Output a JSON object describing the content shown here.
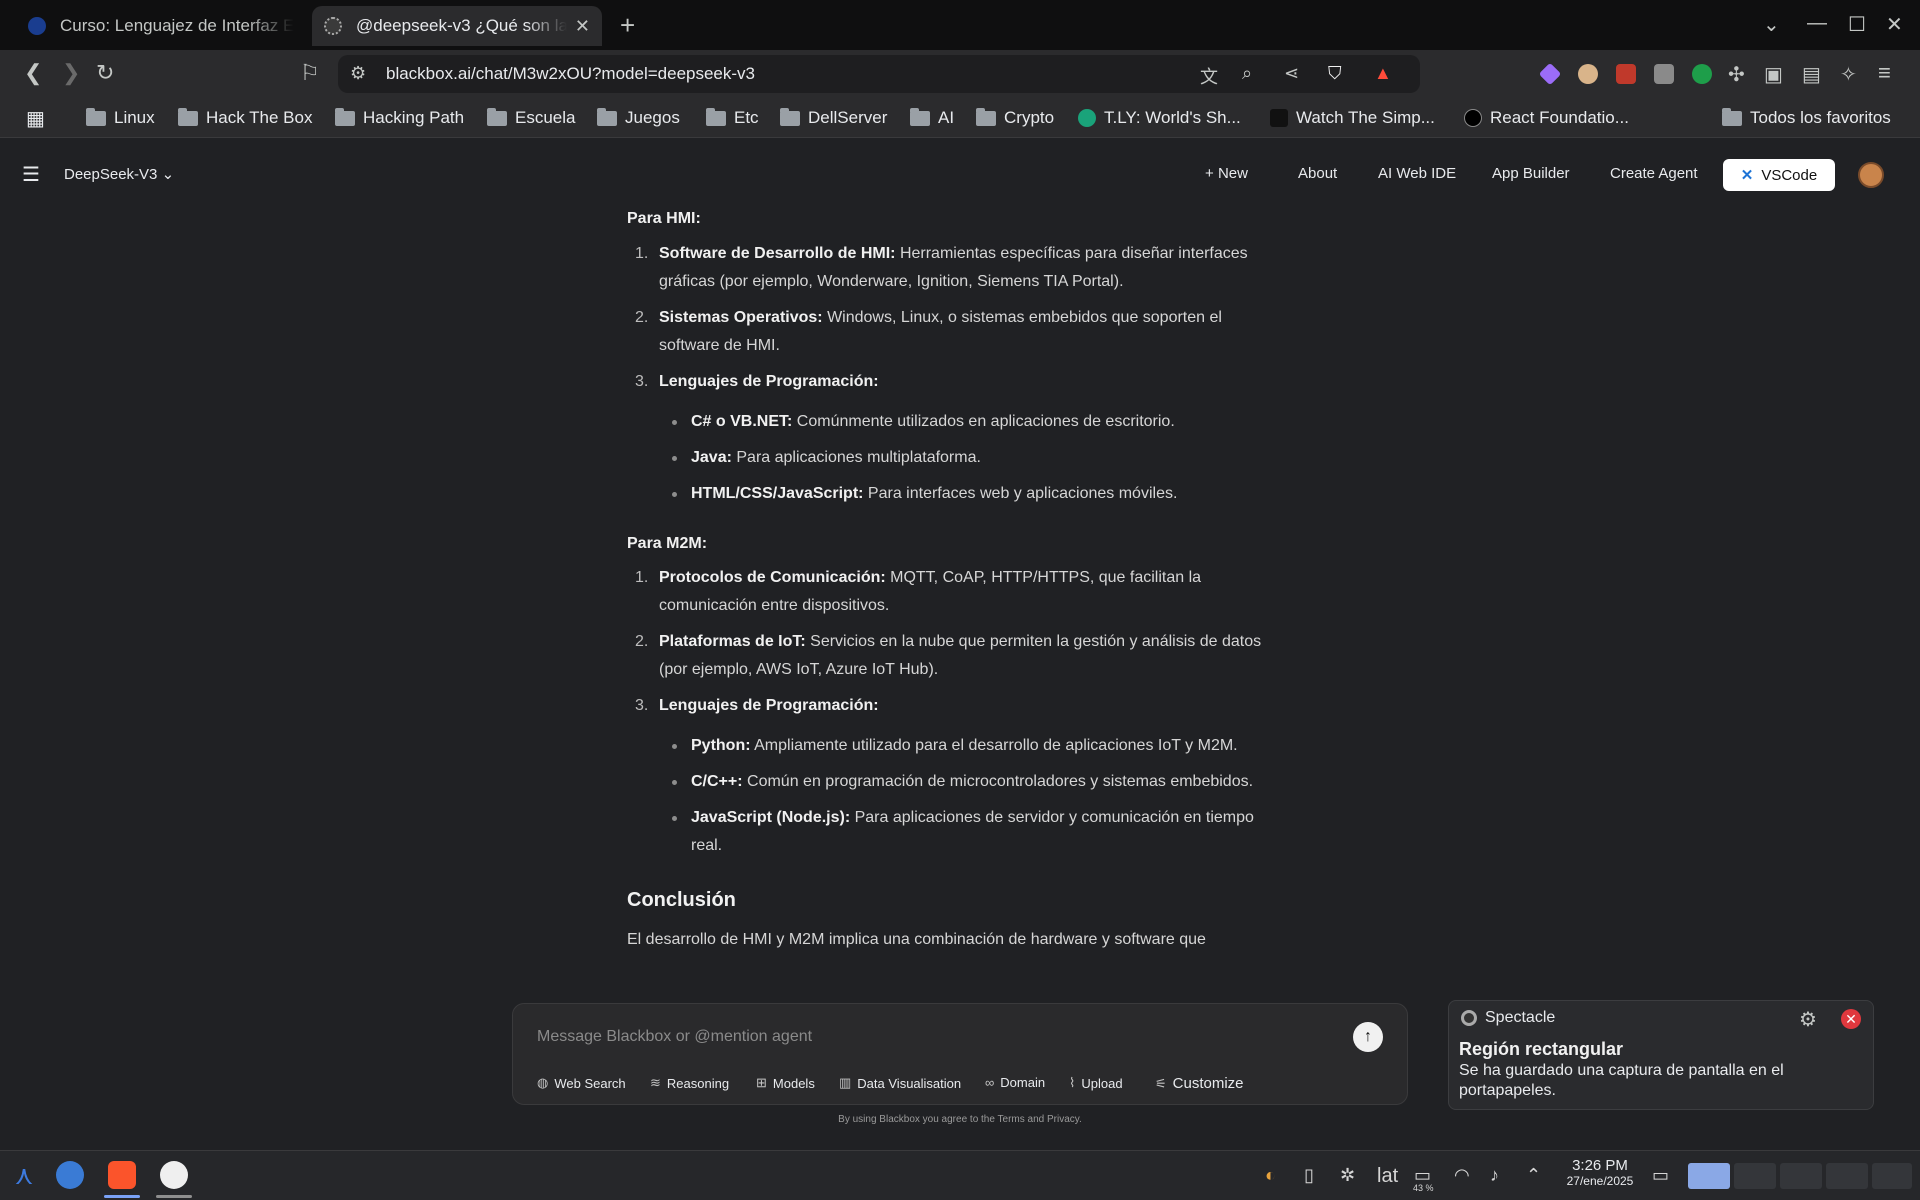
{
  "browser": {
    "tabs": [
      {
        "title": "Curso: Lenguajez de Interfaz E"
      },
      {
        "title": "@deepseek-v3 ¿Qué son la"
      }
    ],
    "url": "blackbox.ai/chat/M3w2xOU?model=deepseek-v3",
    "bookmarks": [
      {
        "label": "Linux",
        "icon": "folder-icon"
      },
      {
        "label": "Hack The Box",
        "icon": "folder-icon"
      },
      {
        "label": "Hacking Path",
        "icon": "folder-icon"
      },
      {
        "label": "Escuela",
        "icon": "folder-icon"
      },
      {
        "label": "Juegos",
        "icon": "folder-icon"
      },
      {
        "label": "Etc",
        "icon": "folder-icon"
      },
      {
        "label": "DellServer",
        "icon": "folder-icon"
      },
      {
        "label": "AI",
        "icon": "folder-icon"
      },
      {
        "label": "Crypto",
        "icon": "folder-icon"
      },
      {
        "label": "T.LY: World's Sh...",
        "icon": "tly-icon"
      },
      {
        "label": "Watch The Simp...",
        "icon": "tv-icon"
      },
      {
        "label": "React Foundatio...",
        "icon": "nextjs-icon"
      }
    ],
    "all_bookmarks": "Todos los favoritos"
  },
  "header": {
    "model": "DeepSeek-V3",
    "new": "New",
    "about": "About",
    "ai_web_ide": "AI Web IDE",
    "app_builder": "App Builder",
    "create_agent": "Create Agent",
    "vscode": "VSCode"
  },
  "content": {
    "hmi_heading": "Para HMI:",
    "hmi_items": [
      {
        "num": "1.",
        "bold": "Software de Desarrollo de HMI:",
        "text": " Herramientas específicas para diseñar interfaces gráficas (por ejemplo, Wonderware, Ignition, Siemens TIA Portal)."
      },
      {
        "num": "2.",
        "bold": "Sistemas Operativos:",
        "text": " Windows, Linux, o sistemas embebidos que soporten el software de HMI."
      },
      {
        "num": "3.",
        "bold": "Lenguajes de Programación:",
        "text": ""
      }
    ],
    "hmi_langs": [
      {
        "bold": "C# o VB.NET:",
        "text": " Comúnmente utilizados en aplicaciones de escritorio."
      },
      {
        "bold": "Java:",
        "text": " Para aplicaciones multiplataforma."
      },
      {
        "bold": "HTML/CSS/JavaScript:",
        "text": " Para interfaces web y aplicaciones móviles."
      }
    ],
    "m2m_heading": "Para M2M:",
    "m2m_items": [
      {
        "num": "1.",
        "bold": "Protocolos de Comunicación:",
        "text": " MQTT, CoAP, HTTP/HTTPS, que facilitan la comunicación entre dispositivos."
      },
      {
        "num": "2.",
        "bold": "Plataformas de IoT:",
        "text": " Servicios en la nube que permiten la gestión y análisis de datos (por ejemplo, AWS IoT, Azure IoT Hub)."
      },
      {
        "num": "3.",
        "bold": "Lenguajes de Programación:",
        "text": ""
      }
    ],
    "m2m_langs": [
      {
        "bold": "Python:",
        "text": " Ampliamente utilizado para el desarrollo de aplicaciones IoT y M2M."
      },
      {
        "bold": "C/C++:",
        "text": " Común en programación de microcontroladores y sistemas embebidos."
      },
      {
        "bold": "JavaScript (Node.js):",
        "text": " Para aplicaciones de servidor y comunicación en tiempo real."
      }
    ],
    "conclusion_heading": "Conclusión",
    "conclusion_text": "El desarrollo de HMI y M2M implica una combinación de hardware y software que"
  },
  "composer": {
    "placeholder": "Message Blackbox or @mention agent",
    "chips": {
      "web_search": "Web Search",
      "reasoning": "Reasoning",
      "models": "Models",
      "data_visualisation": "Data Visualisation",
      "domain": "Domain",
      "upload": "Upload",
      "customize": "Customize"
    },
    "terms": "By using Blackbox you agree to the Terms and Privacy."
  },
  "notification": {
    "app": "Spectacle",
    "title": "Región rectangular",
    "body": "Se ha guardado una captura de pantalla en el portapapeles."
  },
  "taskbar": {
    "keyboard_layout": "lat",
    "battery": "43 %",
    "time": "3:26 PM",
    "date": "27/ene/2025"
  }
}
